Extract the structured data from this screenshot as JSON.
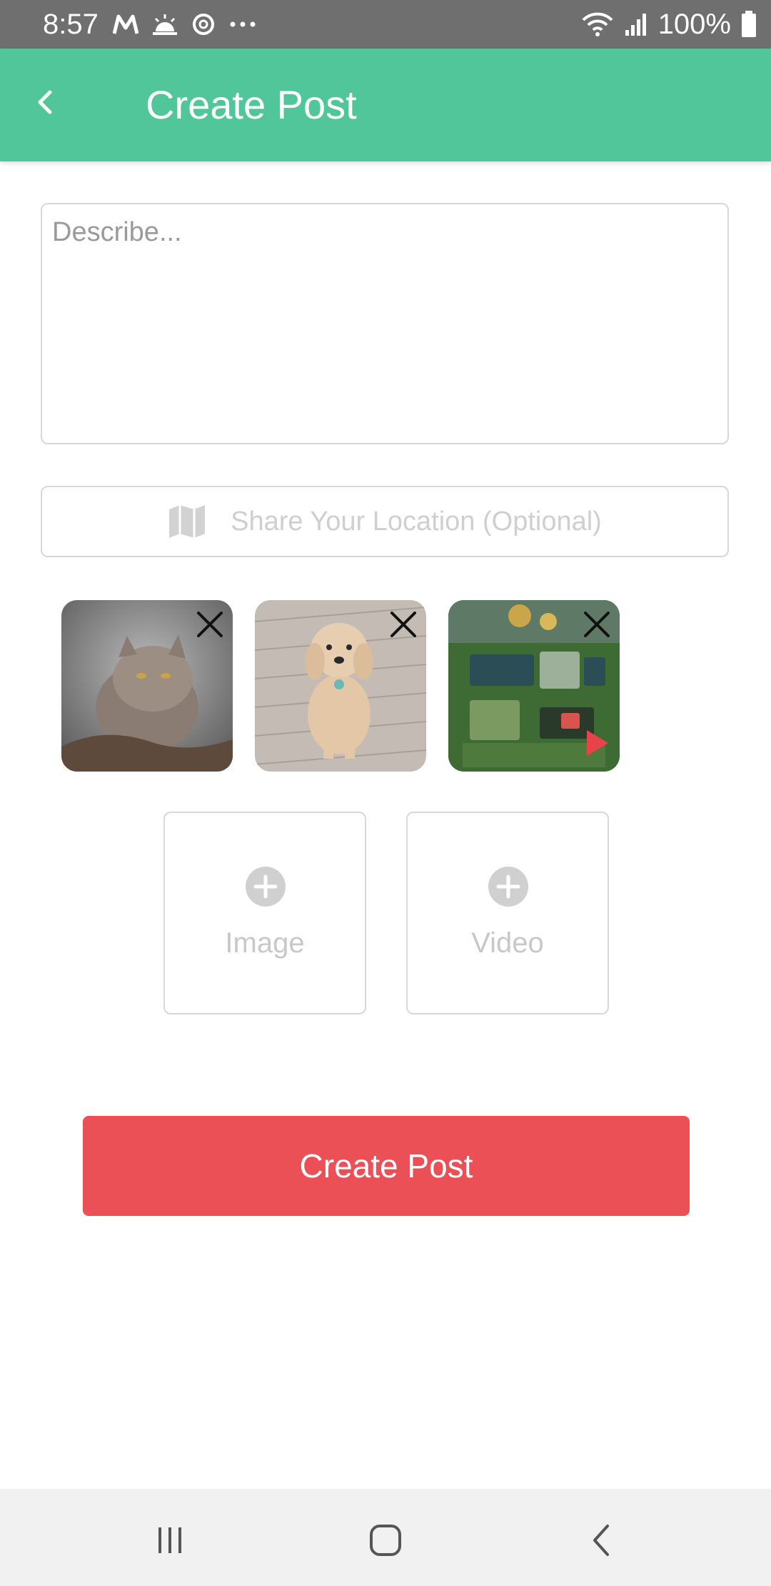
{
  "status_bar": {
    "time": "8:57",
    "left_icons": [
      "motorola-m-icon",
      "weather-sunrise-icon",
      "sync-icon",
      "more-dots-icon"
    ],
    "right_icons": [
      "wifi-icon",
      "signal-icon",
      "battery-icon"
    ],
    "battery_percent": "100%"
  },
  "app_bar": {
    "title": "Create Post",
    "background": "#52c69b"
  },
  "form": {
    "describe_placeholder": "Describe...",
    "location_placeholder": "Share Your Location (Optional)"
  },
  "media": [
    {
      "kind": "image",
      "subject": "grey long-haired cat",
      "remove_icon": "close-icon"
    },
    {
      "kind": "image",
      "subject": "apricot poodle on boardwalk",
      "remove_icon": "close-icon"
    },
    {
      "kind": "video",
      "subject": "garden collage graphic",
      "remove_icon": "close-icon",
      "overlay_icon": "play-icon"
    }
  ],
  "add_buttons": {
    "image_label": "Image",
    "video_label": "Video"
  },
  "submit": {
    "label": "Create Post",
    "background": "#ec5057"
  },
  "nav_bar": {
    "buttons": [
      "recent-apps-icon",
      "home-icon",
      "back-icon"
    ]
  }
}
